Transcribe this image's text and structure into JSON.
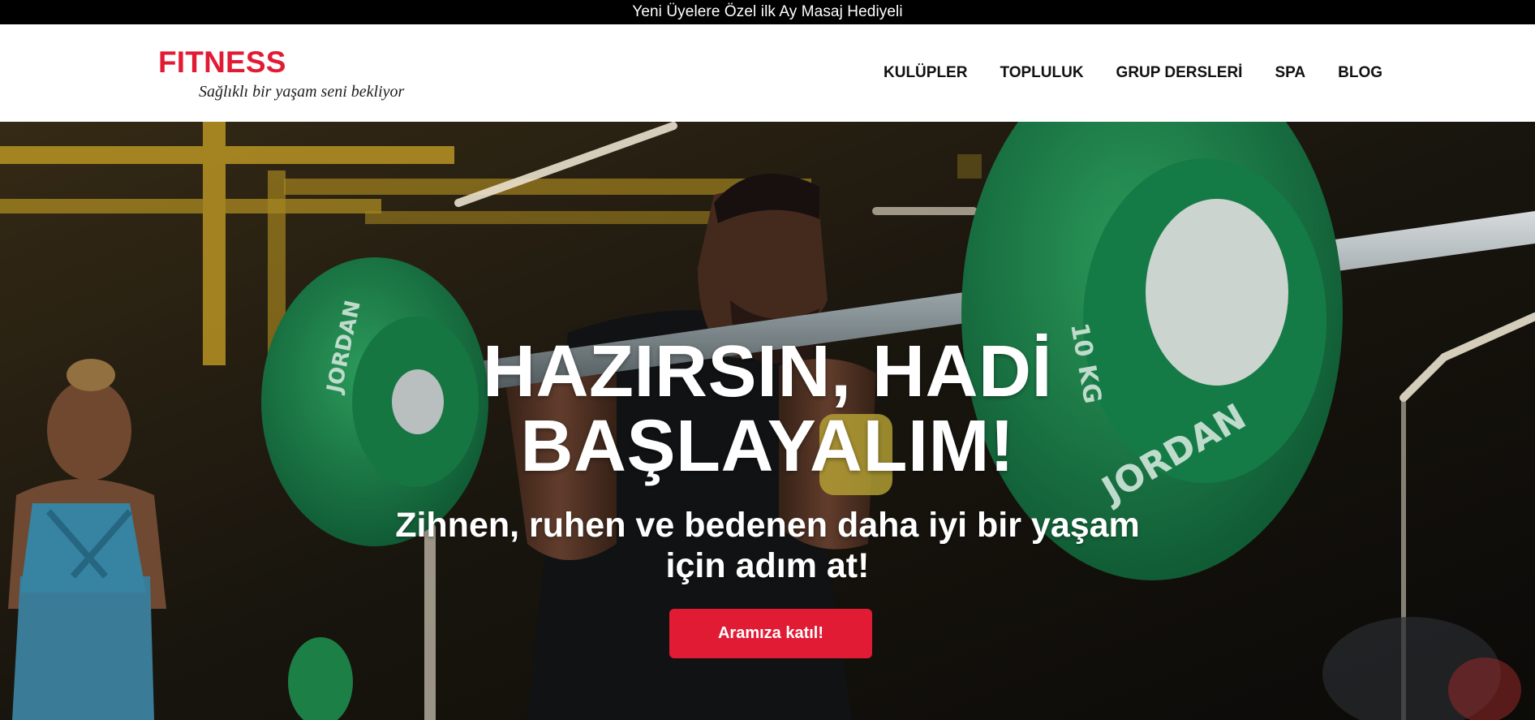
{
  "banner": {
    "text": "Yeni Üyelere Özel ilk Ay Masaj Hediyeli"
  },
  "header": {
    "logo": "FITNESS",
    "tagline": "Sağlıklı bir yaşam seni bekliyor",
    "nav": [
      {
        "label": "KULÜPLER"
      },
      {
        "label": "TOPLULUK"
      },
      {
        "label": "GRUP DERSLERİ"
      },
      {
        "label": "SPA"
      },
      {
        "label": "BLOG"
      }
    ]
  },
  "hero": {
    "title_line1": "HAZIRSIN, HADİ",
    "title_line2": "BAŞLAYALIM!",
    "subtitle_line1": "Zihnen, ruhen ve bedenen daha iyi bir yaşam",
    "subtitle_line2": "için adım at!",
    "cta_label": "Aramıza katıl!",
    "plate_brand": "JORDAN",
    "plate_weight": "10 KG"
  },
  "colors": {
    "brand": "#e21b35",
    "banner_bg": "#000000",
    "plate_green": "#1f8a4c"
  }
}
